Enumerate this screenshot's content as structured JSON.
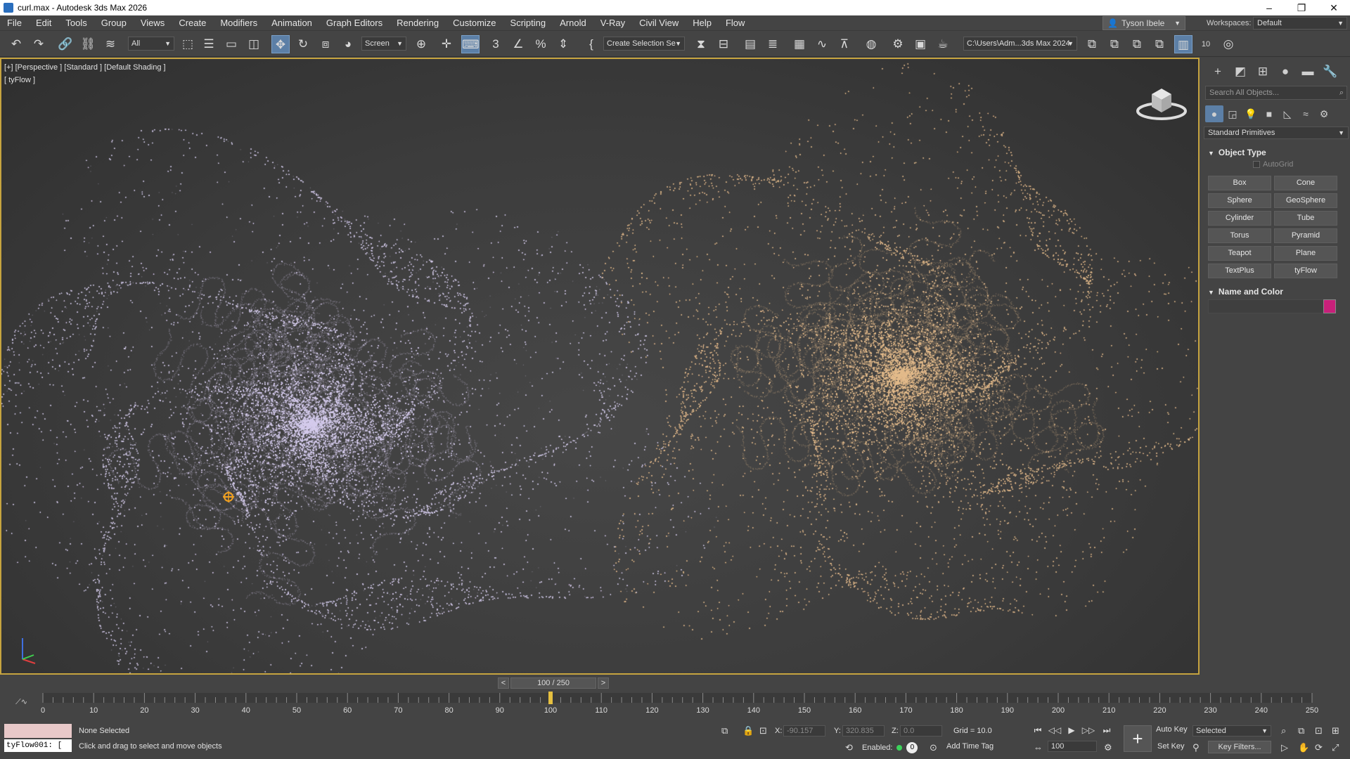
{
  "titlebar": {
    "title": "curl.max - Autodesk 3ds Max 2026",
    "minimize": "–",
    "restore": "❐",
    "close": "✕"
  },
  "menu": [
    "File",
    "Edit",
    "Tools",
    "Group",
    "Views",
    "Create",
    "Modifiers",
    "Animation",
    "Graph Editors",
    "Rendering",
    "Customize",
    "Scripting",
    "Arnold",
    "V-Ray",
    "Civil View",
    "Help",
    "Flow"
  ],
  "user": {
    "name": "Tyson Ibele"
  },
  "workspace": {
    "label": "Workspaces:",
    "value": "Default"
  },
  "toolbar": {
    "selection_filter": "All",
    "ref_coord": "Screen",
    "named_selection": "Create Selection Se",
    "project_path": "C:\\Users\\Adm...3ds Max 2024",
    "snaps_label": "3",
    "render_count": "10"
  },
  "viewport": {
    "label": "[+] [Perspective ] [Standard ] [Default Shading ]",
    "sublabel": "[ tyFlow ]",
    "left_particle_color": "#d7cdee",
    "right_particle_color": "#e6bd8e",
    "frame_border_color": "#c6a43f"
  },
  "command_panel": {
    "search_placeholder": "Search All Objects...",
    "category": "Standard Primitives",
    "object_type_title": "Object Type",
    "autogrid": "AutoGrid",
    "buttons": [
      "Box",
      "Cone",
      "Sphere",
      "GeoSphere",
      "Cylinder",
      "Tube",
      "Torus",
      "Pyramid",
      "Teapot",
      "Plane",
      "TextPlus",
      "tyFlow"
    ],
    "name_color_title": "Name and Color",
    "swatch_color": "#c8207a"
  },
  "timeline": {
    "slider_label": "100 / 250",
    "current_frame": 100,
    "start": 0,
    "end": 250,
    "ticks": [
      "0",
      "10",
      "20",
      "30",
      "40",
      "50",
      "60",
      "70",
      "80",
      "90",
      "100",
      "110",
      "120",
      "130",
      "140",
      "150",
      "160",
      "170",
      "180",
      "190",
      "200",
      "210",
      "220",
      "230",
      "240",
      "250"
    ]
  },
  "status": {
    "selection": "None Selected",
    "prompt": "Click and drag to select and move objects",
    "script_field": "tyFlow001: [",
    "x_label": "X:",
    "x_value": "-90.157",
    "y_label": "Y:",
    "y_value": "320.835",
    "z_label": "Z:",
    "z_value": "0.0",
    "grid": "Grid = 10.0",
    "enabled_label": "Enabled:",
    "enabled_value": "0",
    "add_time_tag": "Add Time Tag",
    "frame": "100",
    "auto_key": "Auto Key",
    "set_key": "Set Key",
    "selected_dd": "Selected",
    "key_filters": "Key Filters..."
  }
}
